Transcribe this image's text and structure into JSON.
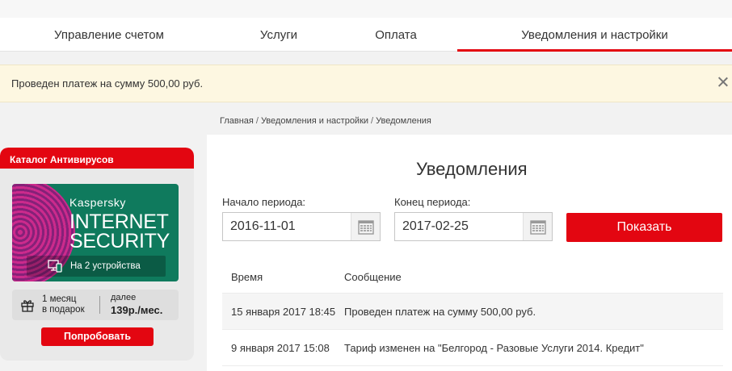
{
  "nav": {
    "tabs": [
      {
        "label": "Управление счетом"
      },
      {
        "label": "Услуги"
      },
      {
        "label": "Оплата"
      },
      {
        "label": "Уведомления и настройки"
      }
    ],
    "active_tab": "Уведомления и настройки"
  },
  "notice": {
    "text": "Проведен платеж на сумму 500,00 руб."
  },
  "breadcrumb": {
    "items": [
      "Главная",
      "Уведомления и настройки",
      "Уведомления"
    ],
    "separator": "/"
  },
  "promo": {
    "title": "Каталог Антивирусов",
    "brand": "Kaspersky",
    "product_line1": "INTERNET",
    "product_line2": "SECURITY",
    "devices": "На 2 устройства",
    "offer_line1": "1 месяц",
    "offer_line2": "в подарок",
    "then_label": "далее",
    "then_price": "139р./мес.",
    "button_label": "Попробовать"
  },
  "main": {
    "title": "Уведомления",
    "start_label": "Начало периода:",
    "start_value": "2016-11-01",
    "end_label": "Конец периода:",
    "end_value": "2017-02-25",
    "show_label": "Показать",
    "table": {
      "headers": [
        "Время",
        "Сообщение"
      ],
      "rows": [
        {
          "time": "15 января 2017 18:45",
          "message": "Проведен платеж на сумму 500,00 руб."
        },
        {
          "time": "9 января 2017 15:08",
          "message": "Тариф изменен на \"Белгород - Разовые Услуги 2014. Кредит\""
        }
      ]
    }
  },
  "colors": {
    "accent": "#e30611",
    "notice_bg": "#fdf7e1",
    "promo_green": "#0f7a5d"
  }
}
